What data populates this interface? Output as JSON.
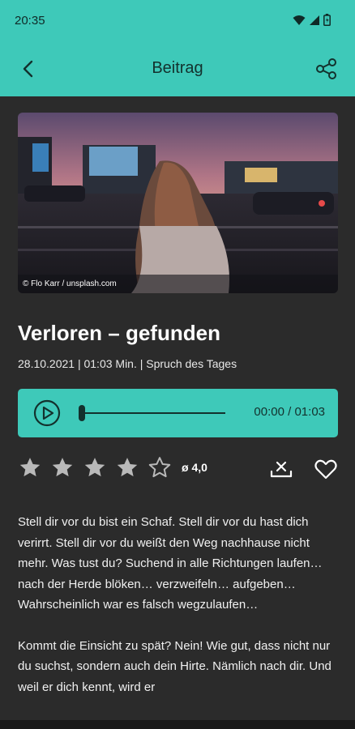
{
  "status_bar": {
    "time": "20:35"
  },
  "app_bar": {
    "title": "Beitrag"
  },
  "hero": {
    "credit": "© Flo Karr / unsplash.com"
  },
  "post": {
    "title": "Verloren – gefunden",
    "meta": "28.10.2021 | 01:03 Min. | Spruch des Tages"
  },
  "player": {
    "time": "00:00 / 01:03",
    "progress": 0
  },
  "rating": {
    "average": "ø 4,0",
    "filled_stars": 4,
    "total_stars": 5
  },
  "body": {
    "paragraphs": [
      "Stell dir vor du bist ein Schaf. Stell dir vor du hast dich verirrt. Stell dir vor du weißt den Weg nachhause nicht mehr. Was tust du? Suchend in alle Richtungen laufen… nach der Herde blöken… verzweifeln… aufgeben… Wahrscheinlich war es falsch wegzulaufen…",
      "Kommt die Einsicht zu spät? Nein! Wie gut, dass nicht nur du suchst, sondern auch dein Hirte. Nämlich nach dir. Und weil er dich kennt, wird er"
    ]
  },
  "colors": {
    "accent": "#3ec9b9",
    "background": "#2b2b2b",
    "on_accent": "#13312d"
  },
  "icons": [
    "wifi-icon",
    "signal-icon",
    "battery-icon",
    "back-arrow-icon",
    "share-icon",
    "play-icon",
    "star-icon",
    "star-outline-icon",
    "remove-download-icon",
    "heart-icon"
  ]
}
